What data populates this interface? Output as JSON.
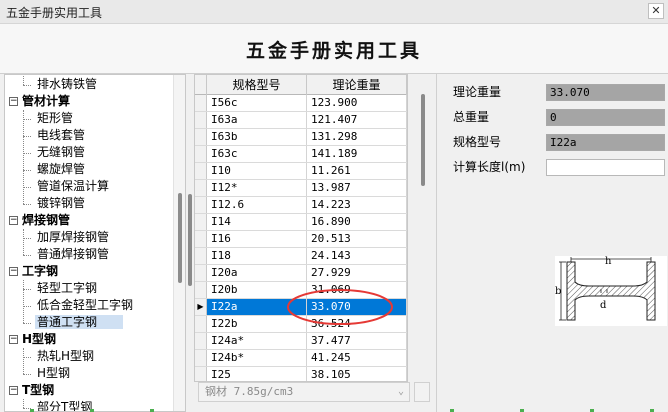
{
  "window": {
    "title": "五金手册实用工具",
    "close_glyph": "✕"
  },
  "header": {
    "app_title": "五金手册实用工具"
  },
  "tree": {
    "items": [
      {
        "label": "排水铸铁管",
        "level": 1
      },
      {
        "label": "管材计算",
        "level": 0,
        "toggle": "−"
      },
      {
        "label": "矩形管",
        "level": 1
      },
      {
        "label": "电线套管",
        "level": 1
      },
      {
        "label": "无缝钢管",
        "level": 1
      },
      {
        "label": "螺旋焊管",
        "level": 1
      },
      {
        "label": "管道保温计算",
        "level": 1
      },
      {
        "label": "镀锌钢管",
        "level": 1
      },
      {
        "label": "焊接钢管",
        "level": 0,
        "toggle": "−"
      },
      {
        "label": "加厚焊接钢管",
        "level": 1
      },
      {
        "label": "普通焊接钢管",
        "level": 1
      },
      {
        "label": "工字钢",
        "level": 0,
        "toggle": "−"
      },
      {
        "label": "轻型工字钢",
        "level": 1
      },
      {
        "label": "低合金轻型工字钢",
        "level": 1
      },
      {
        "label": "普通工字钢",
        "level": 1,
        "selected": true
      },
      {
        "label": "H型钢",
        "level": 0,
        "toggle": "−"
      },
      {
        "label": "热轧H型钢",
        "level": 1
      },
      {
        "label": "H型钢",
        "level": 1
      },
      {
        "label": "T型钢",
        "level": 0,
        "toggle": "−"
      },
      {
        "label": "部分T型钢",
        "level": 1
      }
    ]
  },
  "grid": {
    "columns": [
      "规格型号",
      "理论重量"
    ],
    "row_marker": "▶",
    "rows": [
      [
        "I56c",
        "123.900"
      ],
      [
        "I63a",
        "121.407"
      ],
      [
        "I63b",
        "131.298"
      ],
      [
        "I63c",
        "141.189"
      ],
      [
        "I10",
        "11.261"
      ],
      [
        "I12*",
        "13.987"
      ],
      [
        "I12.6",
        "14.223"
      ],
      [
        "I14",
        "16.890"
      ],
      [
        "I16",
        "20.513"
      ],
      [
        "I18",
        "24.143"
      ],
      [
        "I20a",
        "27.929"
      ],
      [
        "I20b",
        "31.069"
      ],
      [
        "I22a",
        "33.070"
      ],
      [
        "I22b",
        "36.524"
      ],
      [
        "I24a*",
        "37.477"
      ],
      [
        "I24b*",
        "41.245"
      ],
      [
        "I25",
        "38.105"
      ]
    ],
    "selected_index": 12
  },
  "material": {
    "value": "钢材 7.85g/cm3",
    "caret": "⌄"
  },
  "fields": {
    "theory_weight": {
      "label": "理论重量",
      "value": "33.070"
    },
    "total_weight": {
      "label": "总重量",
      "value": "0"
    },
    "spec": {
      "label": "规格型号",
      "value": "I22a"
    },
    "length": {
      "label": "计算长度l(m)",
      "value": ""
    }
  },
  "diagram": {
    "h_label": "h",
    "b_label": "b",
    "d_label": "d"
  },
  "colors": {
    "selection": "#0078d7",
    "highlight_ellipse": "#e53935",
    "tree_selection": "#cfe0f3"
  }
}
